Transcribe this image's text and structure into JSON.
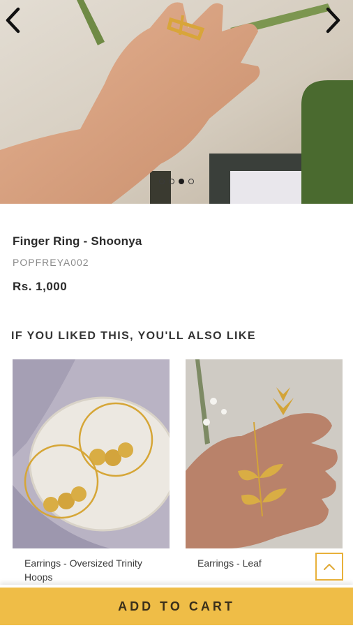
{
  "hero": {
    "slide_count": 4,
    "active_slide": 3,
    "prev_icon": "chevron-left-icon",
    "next_icon": "chevron-right-icon"
  },
  "product": {
    "title": "Finger Ring - Shoonya",
    "sku": "POPFREYA002",
    "price": "Rs. 1,000"
  },
  "recommendations": {
    "heading": "IF YOU LIKED THIS, YOU'LL ALSO LIKE",
    "items": [
      {
        "name": "Earrings - Oversized Trinity Hoops"
      },
      {
        "name": "Earrings - Leaf"
      }
    ]
  },
  "actions": {
    "add_to_cart": "ADD TO CART",
    "scroll_top_icon": "chevron-up-icon"
  },
  "colors": {
    "accent": "#efbd47",
    "scroll_border": "#e8b13a",
    "text_dark": "#2a2a2a",
    "text_muted": "#8a8a8a"
  }
}
